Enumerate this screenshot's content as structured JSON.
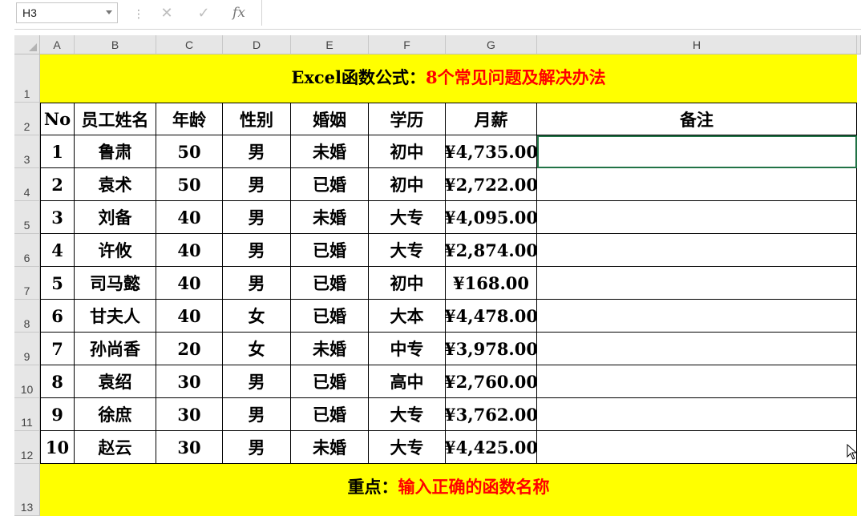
{
  "formula_bar": {
    "name_box": "H3",
    "cancel_icon": "✕",
    "enter_icon": "✓",
    "fx_label": "fx",
    "formula": ""
  },
  "columns": [
    "A",
    "B",
    "C",
    "D",
    "E",
    "F",
    "G",
    "H"
  ],
  "rows": [
    "1",
    "2",
    "3",
    "4",
    "5",
    "6",
    "7",
    "8",
    "9",
    "10",
    "11",
    "12",
    "13"
  ],
  "title": {
    "black": "Excel函数公式：",
    "red": "8个常见问题及解决办法"
  },
  "table": {
    "headers": [
      "No",
      "员工姓名",
      "年龄",
      "性别",
      "婚姻",
      "学历",
      "月薪",
      "备注"
    ],
    "data": [
      [
        "1",
        "鲁肃",
        "50",
        "男",
        "未婚",
        "初中",
        "¥4,735.00",
        ""
      ],
      [
        "2",
        "袁术",
        "50",
        "男",
        "已婚",
        "初中",
        "¥2,722.00",
        ""
      ],
      [
        "3",
        "刘备",
        "40",
        "男",
        "未婚",
        "大专",
        "¥4,095.00",
        ""
      ],
      [
        "4",
        "许攸",
        "40",
        "男",
        "已婚",
        "大专",
        "¥2,874.00",
        ""
      ],
      [
        "5",
        "司马懿",
        "40",
        "男",
        "已婚",
        "初中",
        "¥168.00",
        ""
      ],
      [
        "6",
        "甘夫人",
        "40",
        "女",
        "已婚",
        "大本",
        "¥4,478.00",
        ""
      ],
      [
        "7",
        "孙尚香",
        "20",
        "女",
        "未婚",
        "中专",
        "¥3,978.00",
        ""
      ],
      [
        "8",
        "袁绍",
        "30",
        "男",
        "已婚",
        "高中",
        "¥2,760.00",
        ""
      ],
      [
        "9",
        "徐庶",
        "30",
        "男",
        "已婚",
        "大专",
        "¥3,762.00",
        ""
      ],
      [
        "10",
        "赵云",
        "30",
        "男",
        "未婚",
        "大专",
        "¥4,425.00",
        ""
      ]
    ]
  },
  "footer": {
    "black": "重点：",
    "red": "输入正确的函数名称"
  },
  "colors": {
    "banner_bg": "#ffff00",
    "accent_red": "#ff0000",
    "select": "#217346"
  }
}
